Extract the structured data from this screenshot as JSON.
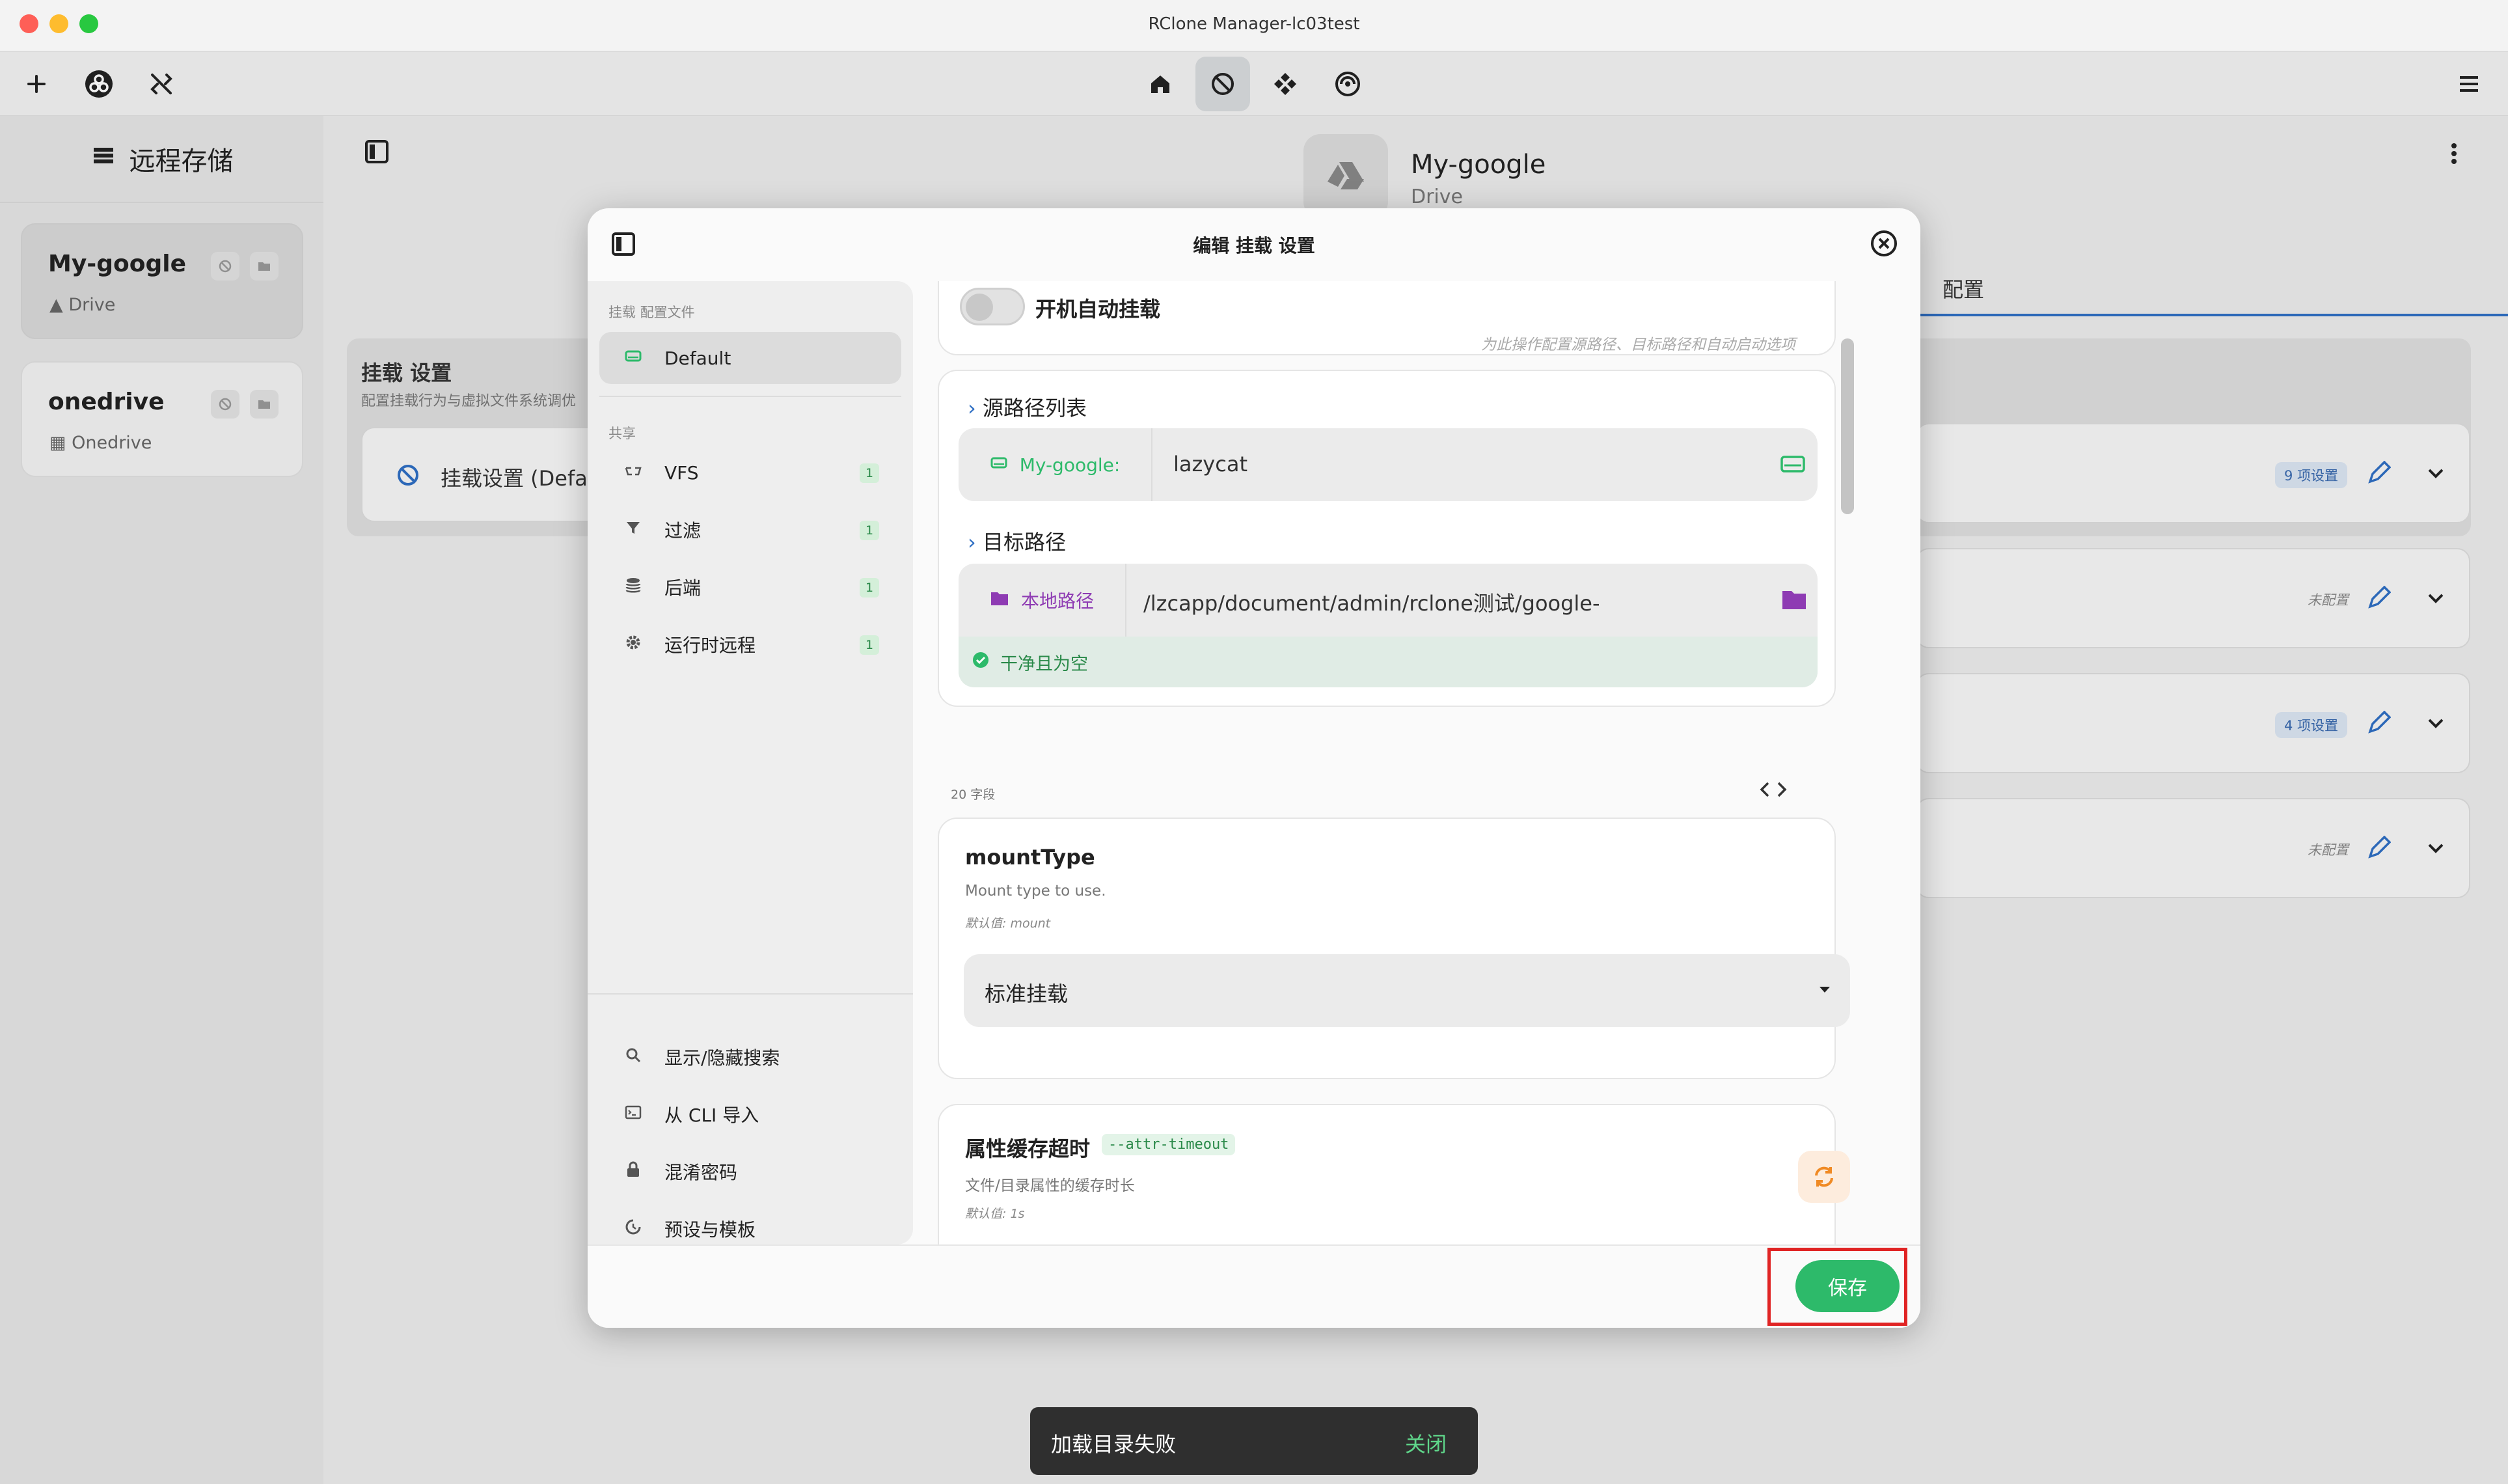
{
  "window": {
    "title": "RClone Manager-lc03test"
  },
  "toolbar": {
    "left_icons": [
      "plus-icon",
      "rclone-logo-icon",
      "disconnect-icon"
    ],
    "center_icons": [
      "home-icon",
      "mount-icon",
      "serve-icon",
      "sync-icon"
    ],
    "right_icon": "menu-icon"
  },
  "sidebar": {
    "title": "远程存储",
    "remotes": [
      {
        "name": "My-google",
        "type": "Drive",
        "selected": true
      },
      {
        "name": "onedrive",
        "type": "Onedrive",
        "selected": false
      }
    ]
  },
  "main": {
    "remote_name": "My-google",
    "remote_type": "Drive",
    "tab_config": "配置",
    "panel_title": "挂载 设置",
    "panel_subtitle": "配置挂载行为与虚拟文件系统调优",
    "panel_item": "挂载设置 (Defau",
    "rows": [
      {
        "tag": "9 项设置"
      },
      {
        "tag": "未配置"
      },
      {
        "tag": "4 项设置"
      },
      {
        "tag": "未配置"
      }
    ]
  },
  "modal": {
    "title": "编辑 挂载 设置",
    "nav": {
      "profiles_label": "挂载 配置文件",
      "profile_default": "Default",
      "shared_label": "共享",
      "items": [
        {
          "label": "VFS",
          "count": "1",
          "icon": "vfs-icon"
        },
        {
          "label": "过滤",
          "count": "1",
          "icon": "filter-icon"
        },
        {
          "label": "后端",
          "count": "1",
          "icon": "backend-icon"
        },
        {
          "label": "运行时远程",
          "count": "1",
          "icon": "gear-icon"
        }
      ],
      "bottom": [
        {
          "label": "显示/隐藏搜索",
          "icon": "search-icon"
        },
        {
          "label": "从 CLI 导入",
          "icon": "terminal-icon"
        },
        {
          "label": "混淆密码",
          "icon": "lock-icon"
        },
        {
          "label": "预设与模板",
          "icon": "template-icon"
        }
      ]
    },
    "autostart": {
      "label": "开机自动挂载",
      "hint": "为此操作配置源路径、目标路径和自动启动选项",
      "enabled": false
    },
    "source": {
      "section": "源路径列表",
      "remote": "My-google:",
      "path": "lazycat"
    },
    "dest": {
      "section": "目标路径",
      "kind": "本地路径",
      "path": "/lzcapp/document/admin/rclone测试/google-",
      "status": "干净且为空"
    },
    "fields_count": "20 字段",
    "mount_type": {
      "label": "mountType",
      "desc": "Mount type to use.",
      "default": "默认值: mount",
      "value": "标准挂载"
    },
    "attr_timeout": {
      "label": "属性缓存超时",
      "flag": "--attr-timeout",
      "desc": "文件/目录属性的缓存时长",
      "default": "默认值: 1s"
    },
    "save_label": "保存"
  },
  "toast": {
    "message": "加载目录失败",
    "action": "关闭"
  },
  "colors": {
    "accent_green": "#2dba6a",
    "purple": "#8e3bb3",
    "blue": "#2f6fc4",
    "highlight_red": "#e02424"
  }
}
